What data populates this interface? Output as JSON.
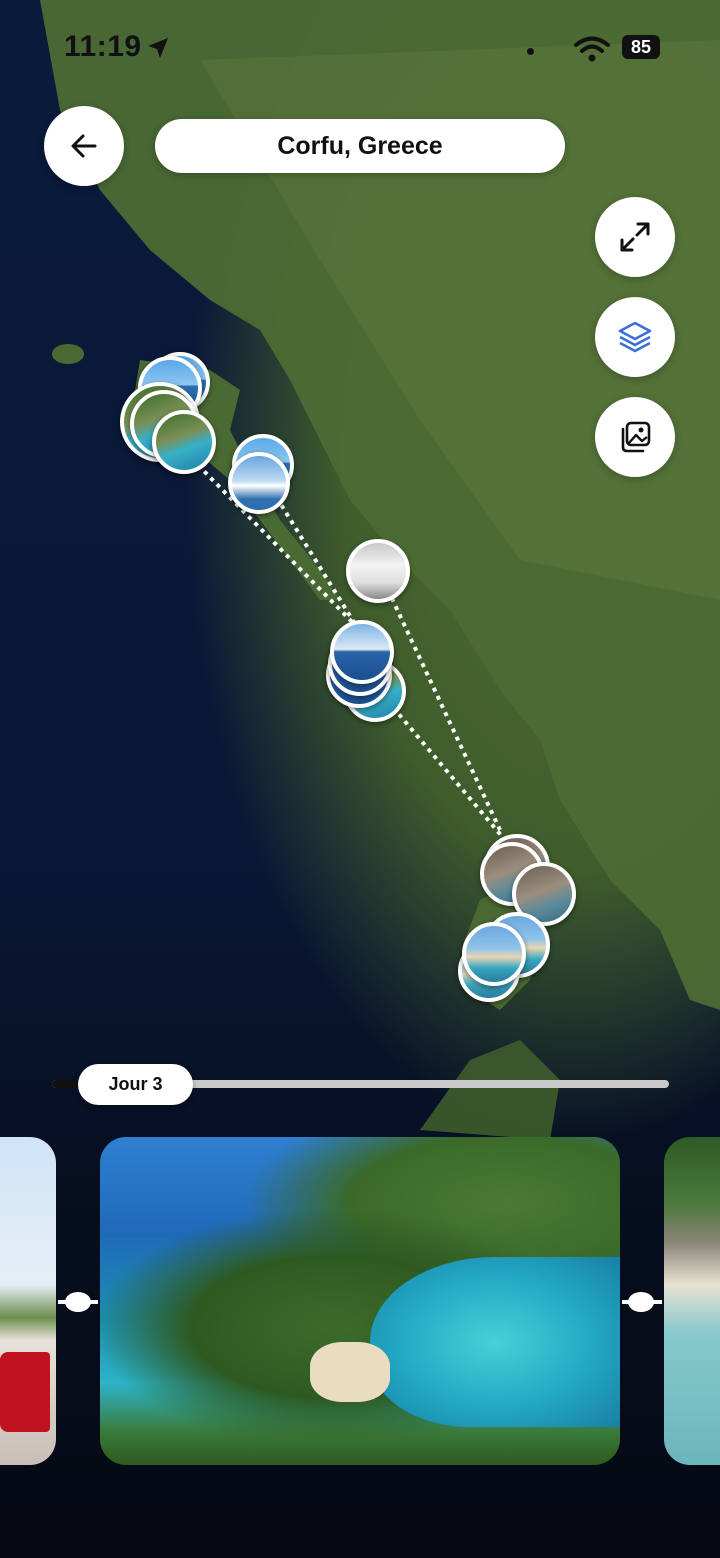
{
  "status_bar": {
    "time": "11:19",
    "battery": "85"
  },
  "header": {
    "title": "Corfu, Greece"
  },
  "controls": {
    "back": "arrow-left-icon",
    "fullscreen": "expand-icon",
    "layers": "layers-icon",
    "gallery": "photo-gallery-icon"
  },
  "timeline": {
    "day_label": "Jour 3"
  },
  "colors": {
    "accent": "#3b6fd9",
    "water": "#0a1a3a",
    "land": "#4f6d35"
  }
}
